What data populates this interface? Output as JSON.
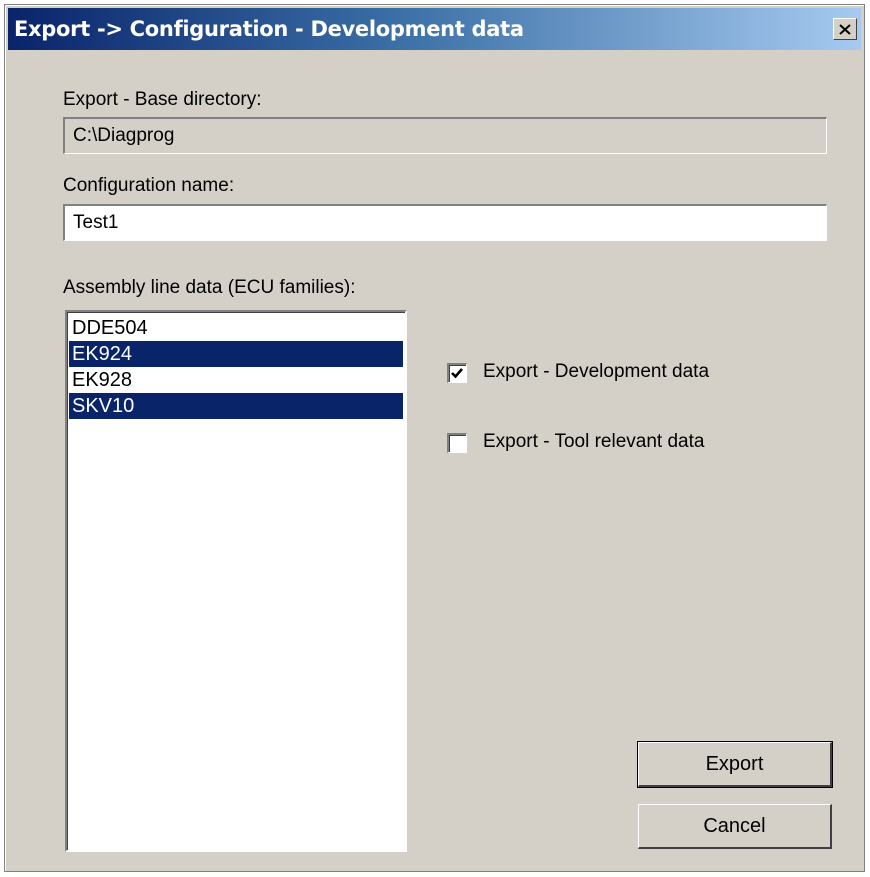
{
  "window": {
    "title": "Export -> Configuration - Development data"
  },
  "base_directory": {
    "label": "Export - Base directory:",
    "value": "C:\\Diagprog"
  },
  "configuration_name": {
    "label": "Configuration name:",
    "value": "Test1"
  },
  "assembly_line": {
    "label": "Assembly line data (ECU families):",
    "items": [
      {
        "label": "DDE504",
        "selected": false
      },
      {
        "label": "EK924",
        "selected": true
      },
      {
        "label": "EK928",
        "selected": false
      },
      {
        "label": "SKV10",
        "selected": true
      }
    ]
  },
  "options": {
    "development_data": {
      "label": "Export - Development data",
      "checked": true
    },
    "tool_relevant_data": {
      "label": "Export - Tool relevant data",
      "checked": false
    }
  },
  "buttons": {
    "export_label": "Export",
    "cancel_label": "Cancel"
  },
  "colors": {
    "selection": "#0a246a",
    "dialog_bg": "#d4d0c8",
    "title_gradient_start": "#0a246a",
    "title_gradient_end": "#a6caf0"
  }
}
